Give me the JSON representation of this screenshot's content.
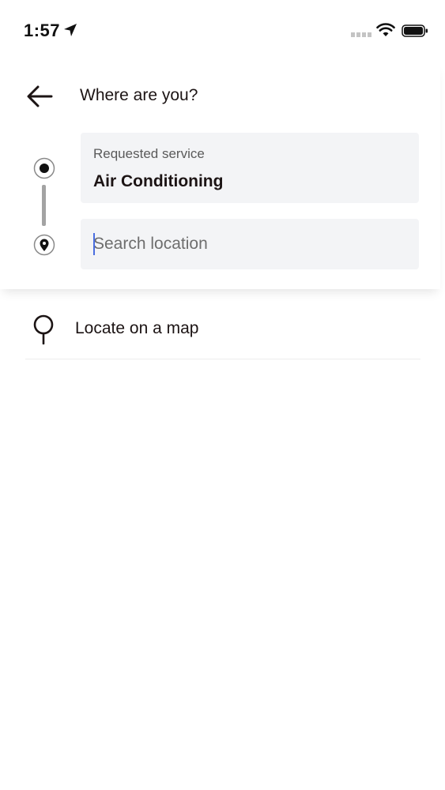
{
  "status_bar": {
    "time": "1:57",
    "icons": [
      "location-arrow-icon",
      "signal-icon",
      "wifi-icon",
      "battery-icon"
    ]
  },
  "header": {
    "title": "Where are you?",
    "back_icon": "arrow-left-icon"
  },
  "route": {
    "origin_icon": "radio-dot-icon",
    "destination_icon": "map-pin-icon"
  },
  "service": {
    "caption": "Requested service",
    "value": "Air Conditioning"
  },
  "search": {
    "placeholder": "Search location",
    "value": ""
  },
  "map_option": {
    "label": "Locate on a map",
    "icon": "pin-outline-icon"
  },
  "colors": {
    "field_background": "#f3f4f6",
    "text": "#1c1414",
    "caret": "#4a6ee0"
  }
}
